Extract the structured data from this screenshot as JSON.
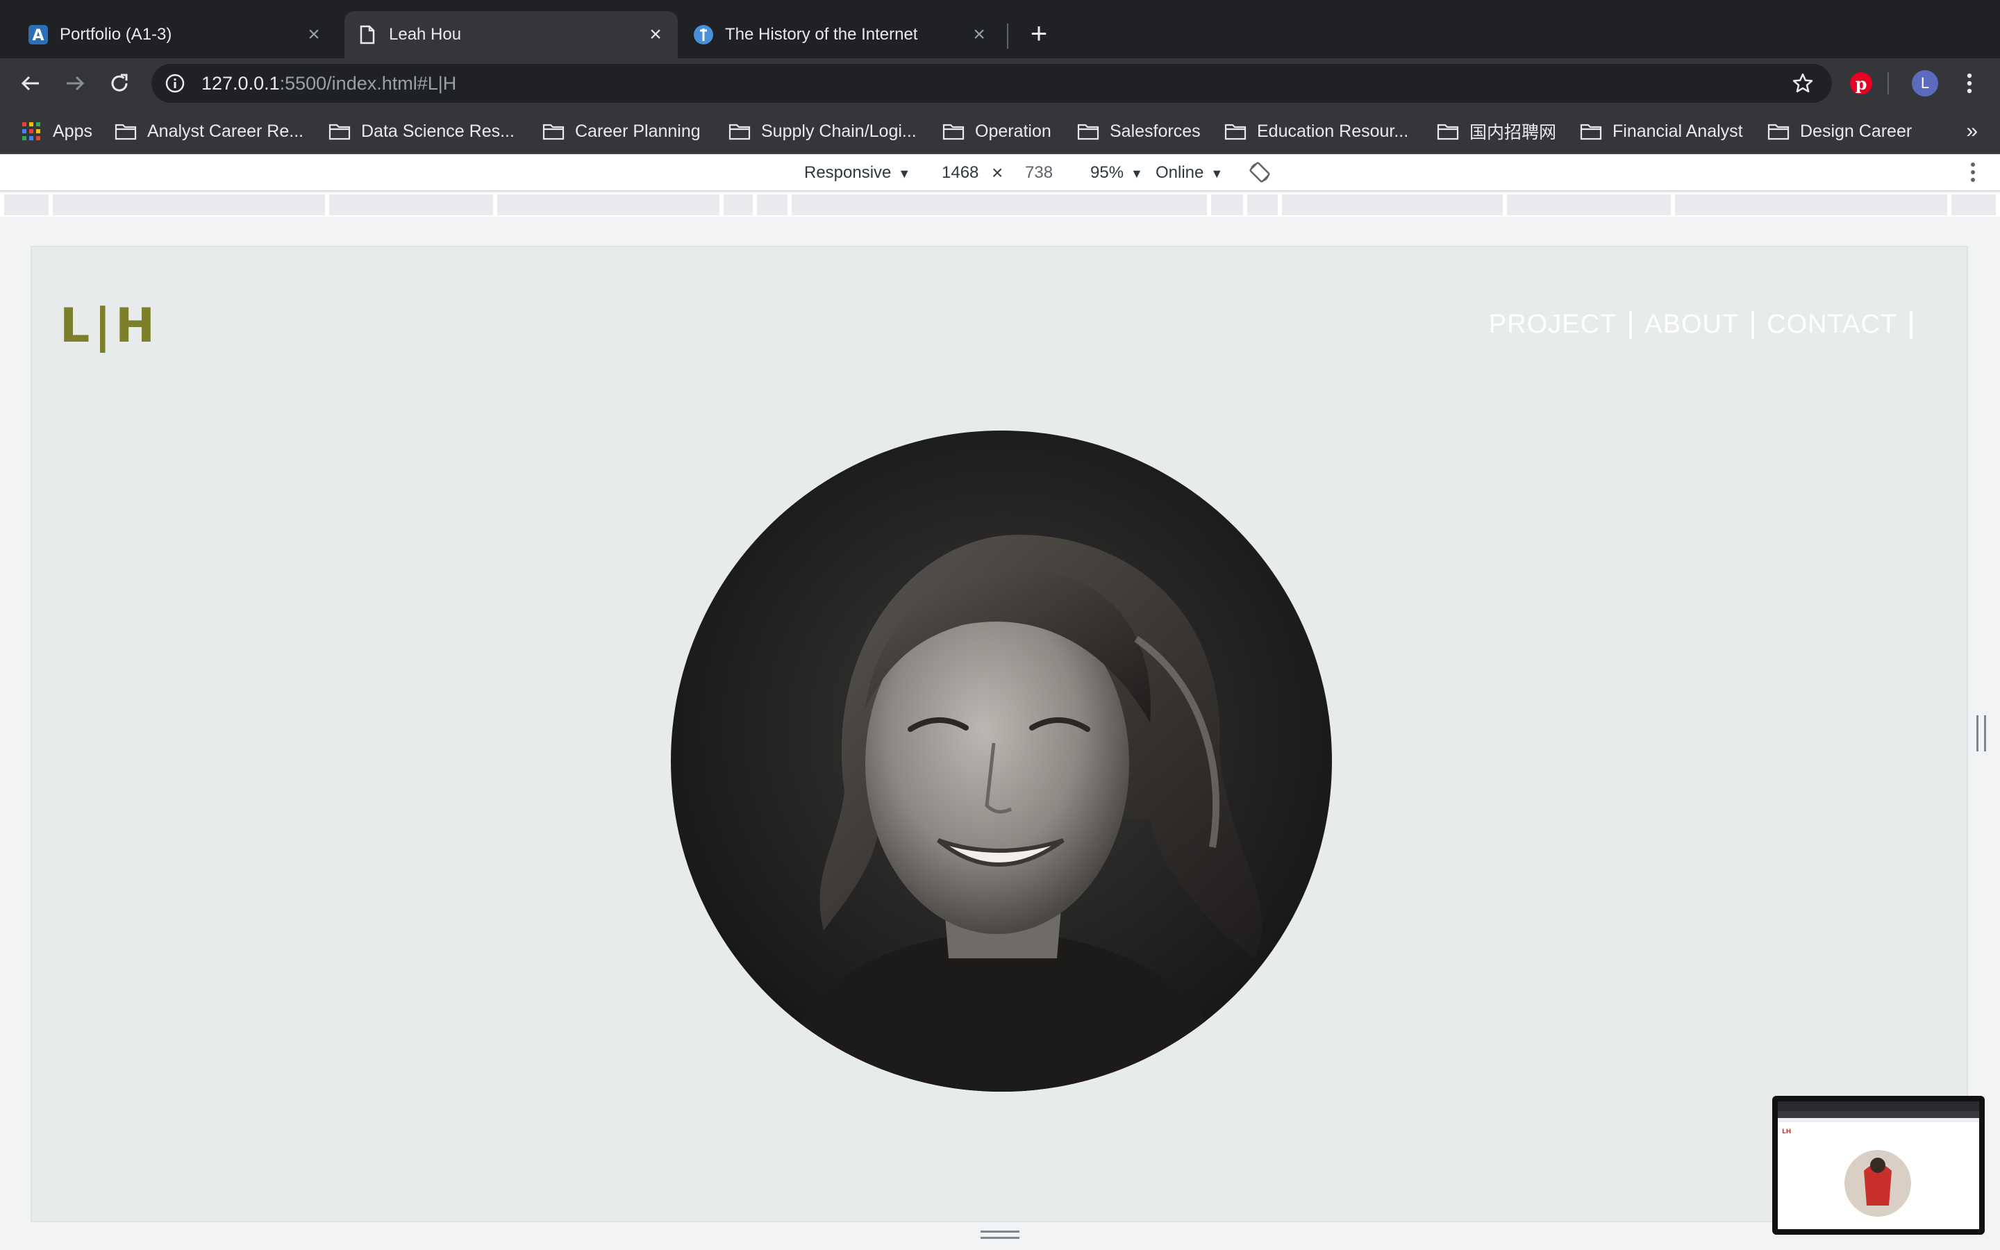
{
  "tabs": [
    {
      "title": "Portfolio (A1-3)",
      "icon": "app-favicon-icon",
      "active": false
    },
    {
      "title": "Leah Hou",
      "icon": "page-icon",
      "active": true
    },
    {
      "title": "The History of the Internet",
      "icon": "site-favicon-icon",
      "active": false
    }
  ],
  "omnibox": {
    "url_host": "127.0.0.1",
    "url_rest": ":5500/index.html#L|H"
  },
  "profile": {
    "initial": "L"
  },
  "bookmarks": {
    "apps": "Apps",
    "folders": [
      "Analyst Career Re...",
      "Data Science Res...",
      "Career Planning",
      "Supply Chain/Logi...",
      "Operation",
      "Salesforces",
      "Education Resour...",
      "国内招聘网",
      "Financial Analyst",
      "Design Career"
    ],
    "more": "»"
  },
  "devtools": {
    "device": "Responsive",
    "width": "1468",
    "times": "×",
    "height": "738",
    "zoom": "95%",
    "network": "Online"
  },
  "site": {
    "logo": "L|H",
    "nav": [
      "PROJECT",
      "ABOUT",
      "CONTACT"
    ]
  },
  "colors": {
    "logo": "#7d7f2b",
    "page_bg": "#e8ebeb",
    "nav_text": "#ffffff"
  }
}
